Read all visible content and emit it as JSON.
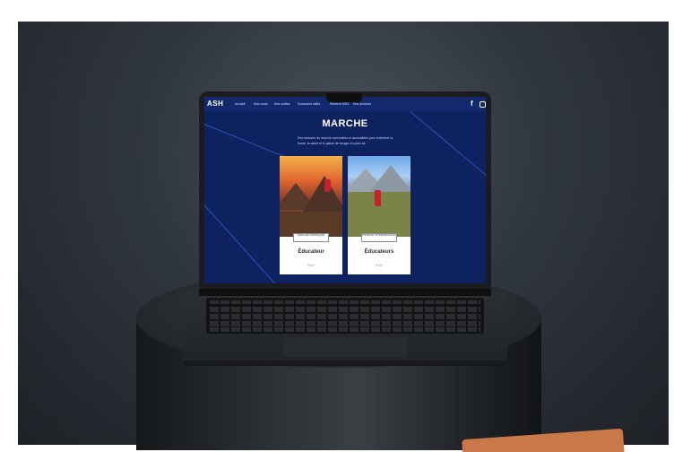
{
  "site": {
    "logo": "ASH",
    "nav": [
      "Accueil",
      "Nos cours",
      "Nos sorties",
      "Document utiles",
      "Réservé ASH",
      "Nos archives"
    ],
    "social_icons": [
      "facebook-icon",
      "instagram-icon"
    ],
    "page_title": "MARCHE",
    "intro": "Des séances de marche conviviales et accessibles pour entretenir la forme, la santé et le plaisir de bouger en plein air.",
    "cards": [
      {
        "tag": "MARCHE NORDIQUE",
        "title": "Éducateur",
        "link": "Plus+"
      },
      {
        "tag": "MARCHE INTERMÉDIAIRE",
        "title": "Éducateurs",
        "link": "Plus+"
      }
    ]
  },
  "colors": {
    "screen_bg": "#0e2260",
    "nav_bg": "#13296e",
    "background": "#30363d"
  }
}
